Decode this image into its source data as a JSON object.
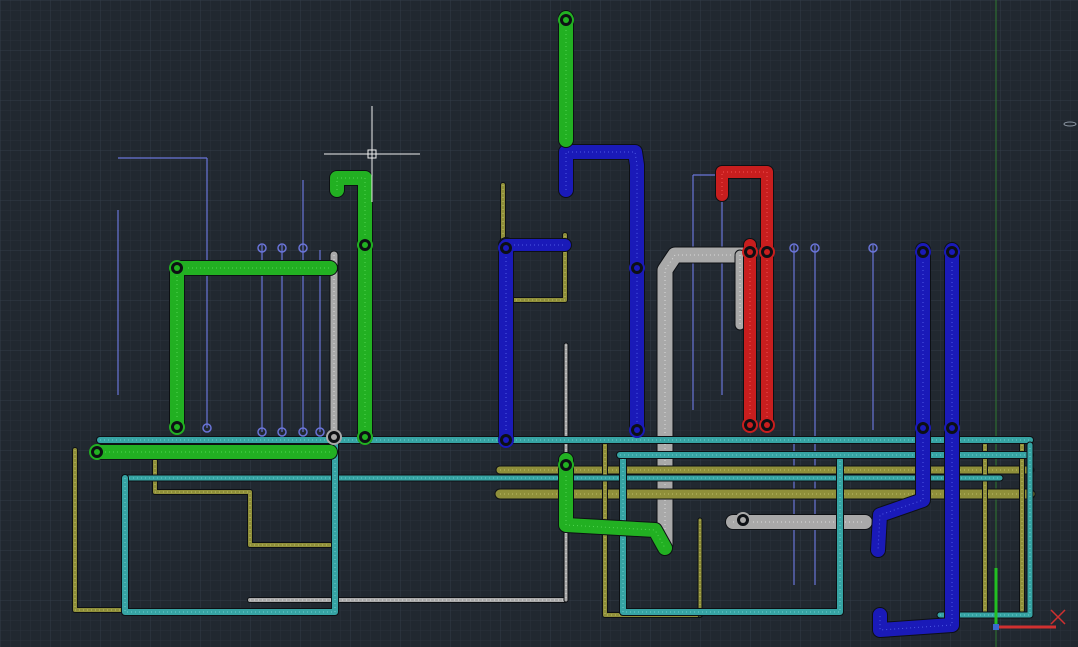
{
  "colors": {
    "background": "#212830",
    "grid_minor": "#2a323c",
    "grid_major": "#323c47",
    "green": "#22b022",
    "green_light": "#5fe05f",
    "blue": "#1a1ab8",
    "blue_light": "#5a6af0",
    "red": "#c81e1e",
    "red_light": "#ff6060",
    "gray": "#a9a9a9",
    "gray_light": "#e6e6e6",
    "cyan": "#36a3a3",
    "olive": "#8f8f3a",
    "olive_light": "#c8c870",
    "thin_blue": "#6a74d8",
    "crosshair": "#f0f0f0",
    "y_axis": "#3aa83a",
    "x_axis_red": "#e04848",
    "ucs_green": "#22c022",
    "ucs_red": "#d03030"
  },
  "icons": {
    "crosshair": "crosshair-cursor-icon",
    "ucs": "ucs-axes-icon",
    "close": "close-x-icon"
  }
}
